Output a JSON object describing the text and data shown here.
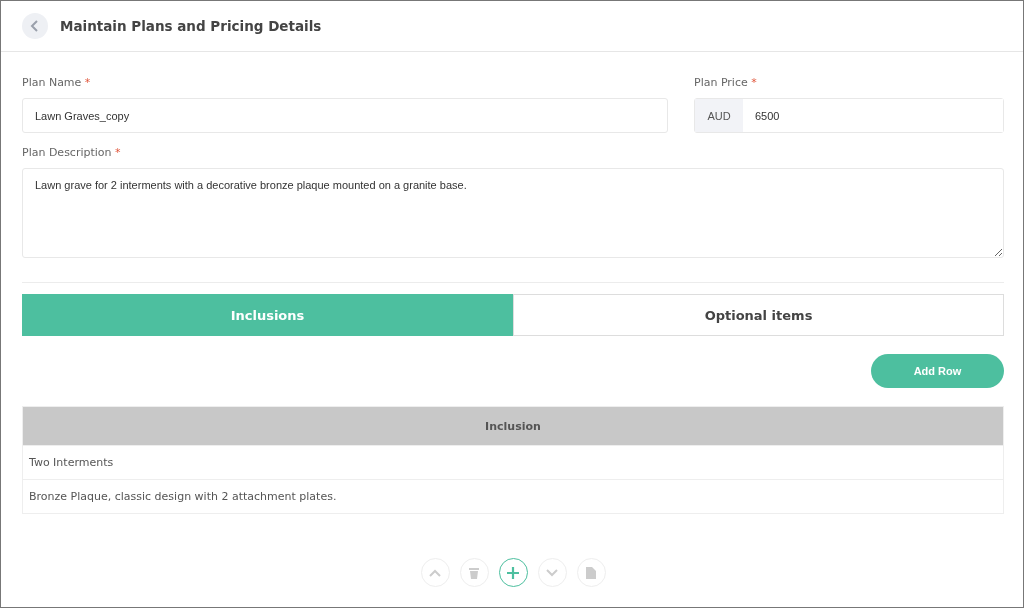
{
  "header": {
    "title": "Maintain Plans and Pricing Details"
  },
  "plan_name": {
    "label": "Plan Name",
    "required_mark": "*",
    "value": "Lawn Graves_copy"
  },
  "plan_price": {
    "label": "Plan Price",
    "required_mark": "*",
    "currency": "AUD",
    "value": "6500"
  },
  "plan_description": {
    "label": "Plan Description",
    "required_mark": "*",
    "value": "Lawn grave for 2 interments with a decorative bronze plaque mounted on a granite base."
  },
  "tabs": [
    {
      "label": "Inclusions",
      "selected": true
    },
    {
      "label": "Optional items",
      "selected": false
    }
  ],
  "add_row_button": "Add Row",
  "table": {
    "columns": [
      "Inclusion"
    ],
    "rows": [
      [
        "Two Interments"
      ],
      [
        "Bronze Plaque, classic design with 2 attachment plates."
      ]
    ]
  },
  "toolbar": [
    {
      "kind": "up",
      "disabled": true
    },
    {
      "kind": "delete",
      "disabled": true
    },
    {
      "kind": "add",
      "disabled": false
    },
    {
      "kind": "down",
      "disabled": true
    },
    {
      "kind": "document",
      "disabled": true
    }
  ]
}
